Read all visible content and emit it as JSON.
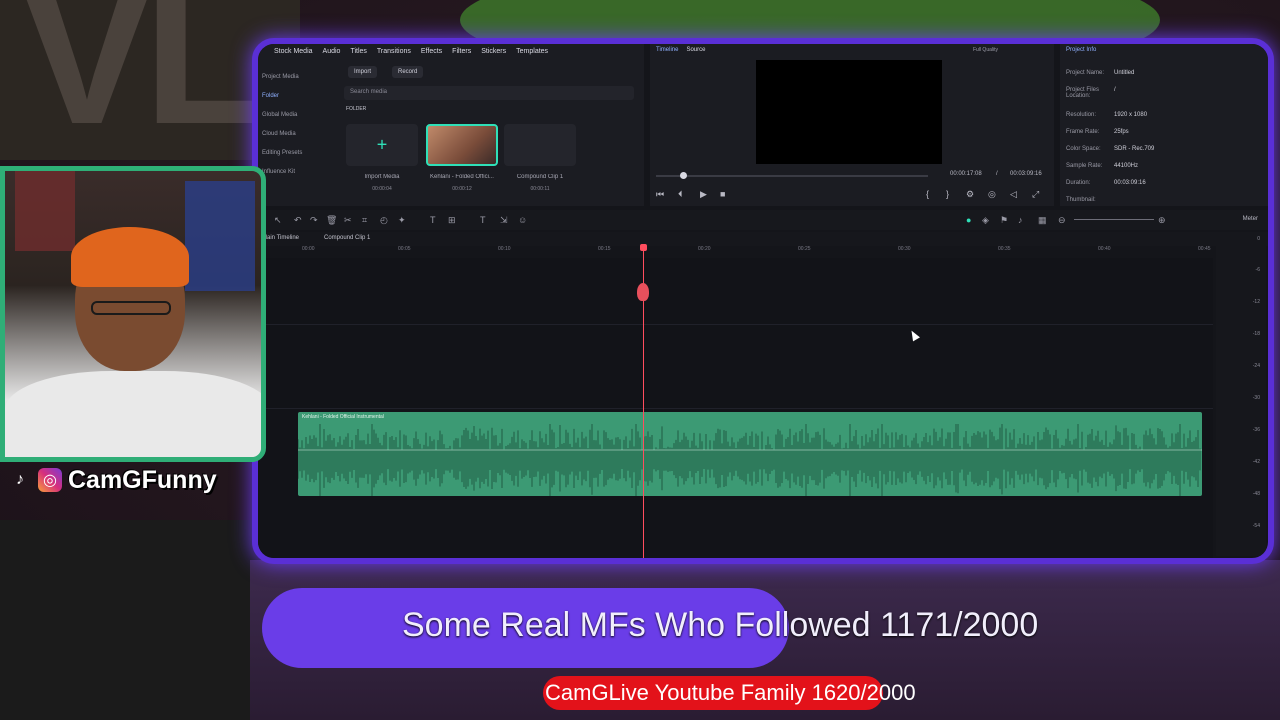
{
  "editor": {
    "media_tabs": [
      "Stock Media",
      "Audio",
      "Titles",
      "Transitions",
      "Effects",
      "Filters",
      "Stickers",
      "Templates"
    ],
    "sidebar": [
      "Project Media",
      "Folder",
      "Global Media",
      "Cloud Media",
      "Editing Presets",
      "Influence Kit"
    ],
    "import_label": "Import",
    "record_label": "Record",
    "search_placeholder": "Search media",
    "folder_label": "FOLDER",
    "media_items": [
      {
        "caption": "Import Media",
        "duration": "00:00:04"
      },
      {
        "caption": "Kehlani - Folded Offici...",
        "duration": "00:00:12"
      },
      {
        "caption": "Compound Clip 1",
        "duration": "00:00:11"
      }
    ],
    "player": {
      "tab_timeline": "Timeline",
      "tab_source": "Source",
      "quality": "Full Quality",
      "current_time": "00:00:17:08",
      "separator": "/",
      "total_time": "00:03:09:16"
    },
    "project_info": {
      "title": "Project Info",
      "rows": [
        {
          "key": "Project Name:",
          "value": "Untitled"
        },
        {
          "key": "Project Files Location:",
          "value": "/"
        },
        {
          "key": "Resolution:",
          "value": "1920 x 1080"
        },
        {
          "key": "Frame Rate:",
          "value": "25fps"
        },
        {
          "key": "Color Space:",
          "value": "SDR - Rec.709"
        },
        {
          "key": "Sample Rate:",
          "value": "44100Hz"
        },
        {
          "key": "Duration:",
          "value": "00:03:09:16"
        },
        {
          "key": "Thumbnail:",
          "value": ""
        }
      ]
    },
    "toolbar_meter": "Meter",
    "timeline_tabs": [
      "Main Timeline",
      "Compound Clip 1"
    ],
    "ruler": [
      "00:00",
      "00:05",
      "00:10",
      "00:15",
      "00:20",
      "00:25",
      "00:30",
      "00:35",
      "00:40",
      "00:45"
    ],
    "audio_clip_label": "Kehlani - Folded Official Instrumental",
    "db_scale": [
      "0",
      "-6",
      "-12",
      "-18",
      "-24",
      "-30",
      "-36",
      "-42",
      "-48",
      "-54"
    ]
  },
  "overlay": {
    "handle": "CamGFunny",
    "goal_main_text": "Some Real MFs Who Followed 1171/2000",
    "goal_main_progress": 0.5855,
    "goal_sub_text": "CamGLive Youtube Family 1620/2000",
    "goal_sub_progress": 0.81,
    "colors": {
      "frame": "#5a2fd6",
      "main_bar": "#6a3de8",
      "sub_bar": "#e3121a",
      "webcam_border": "#2fae77"
    }
  }
}
